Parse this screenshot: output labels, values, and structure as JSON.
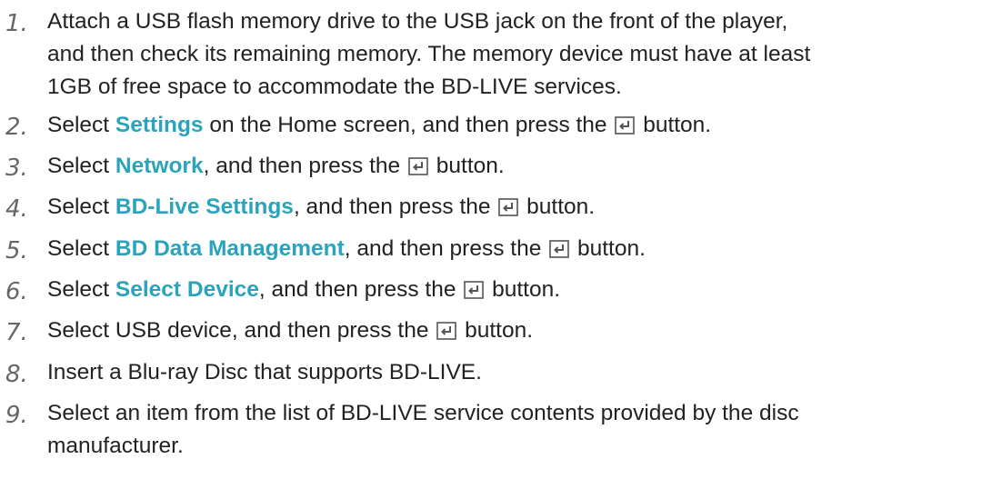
{
  "steps": [
    {
      "num": "1.",
      "line1": "Attach a USB flash memory drive to the USB jack on the front of the player,",
      "line2": "and then check its remaining memory. The memory device must have at least",
      "line3": "1GB of free space to accommodate the BD-LIVE services."
    },
    {
      "num": "2.",
      "pre": "Select ",
      "hl": "Settings",
      "post": " on the Home screen, and then press the",
      "end": "button.",
      "icon": "enter-icon"
    },
    {
      "num": "3.",
      "pre": "Select ",
      "hl": "Network",
      "post": ", and then press the",
      "end": "button.",
      "icon": "enter-icon"
    },
    {
      "num": "4.",
      "pre": "Select ",
      "hl": "BD-Live Settings",
      "post": ", and then press the",
      "end": "button.",
      "icon": "enter-icon"
    },
    {
      "num": "5.",
      "pre": "Select ",
      "hl": "BD Data Management",
      "post": ", and then press the",
      "end": "button.",
      "icon": "enter-icon"
    },
    {
      "num": "6.",
      "pre": "Select ",
      "hl": "Select Device",
      "post": ", and then press the",
      "end": "button.",
      "icon": "enter-icon"
    },
    {
      "num": "7.",
      "pre": "Select USB device, and then press the",
      "end": "button.",
      "icon": "enter-icon"
    },
    {
      "num": "8.",
      "text": "Insert a Blu-ray Disc that supports BD-LIVE."
    },
    {
      "num": "9.",
      "line1": "Select an item from the list of BD-LIVE service contents provided by the disc",
      "line2": "manufacturer."
    }
  ],
  "colors": {
    "highlight": "#2aa3bd",
    "text": "#222222",
    "number": "#666666"
  }
}
